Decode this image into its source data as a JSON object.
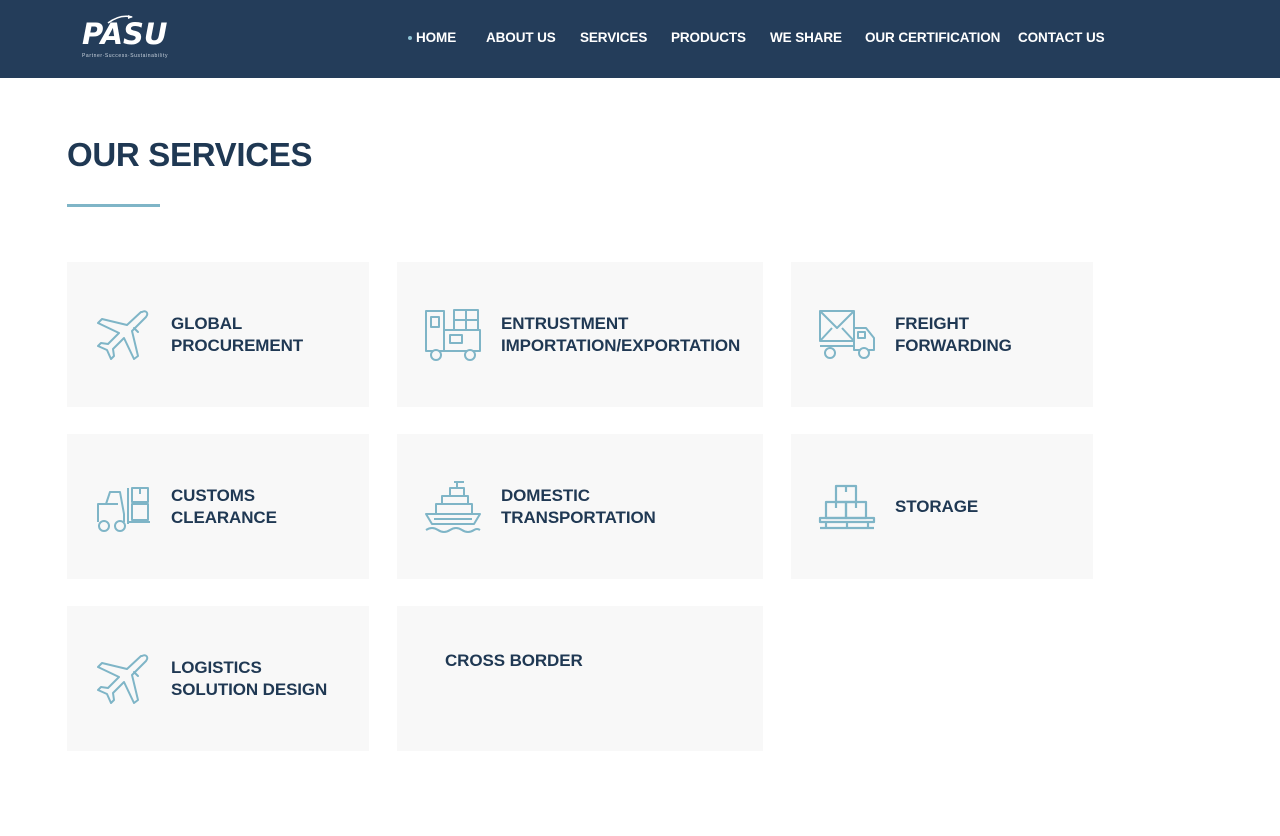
{
  "brand": {
    "logo_text": "PASU",
    "tagline": "Partner·Success·Sustainability"
  },
  "nav": {
    "items": [
      {
        "label": "HOME",
        "active": true
      },
      {
        "label": "ABOUT US"
      },
      {
        "label": "SERVICES"
      },
      {
        "label": "PRODUCTS"
      },
      {
        "label": "WE SHARE"
      },
      {
        "label": "OUR CERTIFICATION"
      },
      {
        "label": "CONTACT US"
      }
    ]
  },
  "main": {
    "title": "OUR SERVICES",
    "services": [
      {
        "label": "GLOBAL\nPROCUREMENT",
        "icon": "airplane-icon"
      },
      {
        "label": "ENTRUSTMENT\nIMPORTATION/EXPORTATION",
        "icon": "truck-cargo-icon"
      },
      {
        "label": "FREIGHT\nFORWARDING",
        "icon": "delivery-truck-icon"
      },
      {
        "label": "CUSTOMS\nCLEARANCE",
        "icon": "forklift-icon"
      },
      {
        "label": "DOMESTIC\nTRANSPORTATION",
        "icon": "cargo-ship-icon"
      },
      {
        "label": "STORAGE",
        "icon": "boxes-pallet-icon"
      },
      {
        "label": "LOGISTICS\nSOLUTION DESIGN",
        "icon": "airplane-icon"
      },
      {
        "label": "CROSS BORDER",
        "icon": ""
      }
    ]
  },
  "colors": {
    "header_bg": "#243d5a",
    "accent": "#7fb5c7",
    "heading": "#1f3853",
    "card_bg": "#f8f8f8"
  }
}
